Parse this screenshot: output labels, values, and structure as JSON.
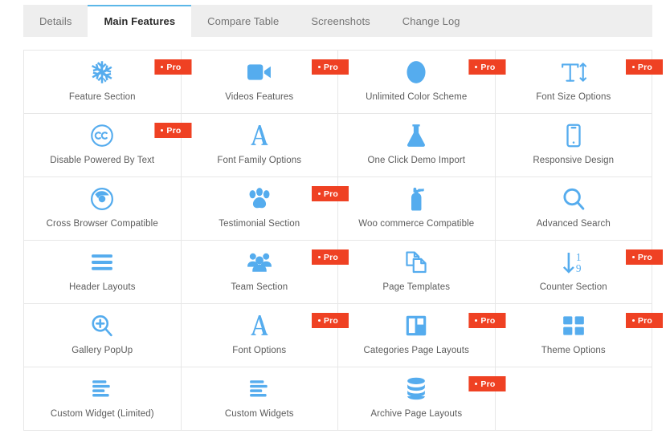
{
  "tabs": [
    {
      "label": "Details",
      "active": false
    },
    {
      "label": "Main Features",
      "active": true
    },
    {
      "label": "Compare Table",
      "active": false
    },
    {
      "label": "Screenshots",
      "active": false
    },
    {
      "label": "Change Log",
      "active": false
    }
  ],
  "colors": {
    "icon_blue": "#55acee",
    "pro_red": "#ef4123",
    "tab_active_underline": "#5bb7e8",
    "tabbar_background": "#eeeeee",
    "card_border": "#e7e7e7",
    "label_text": "#5b5b5b"
  },
  "pro_badge_label": "Pro",
  "features": [
    {
      "label": "Feature Section",
      "icon": "snowflake-icon",
      "pro": true
    },
    {
      "label": "Videos Features",
      "icon": "video-camera-icon",
      "pro": true
    },
    {
      "label": "Unlimited Color Scheme",
      "icon": "color-circle-icon",
      "pro": true
    },
    {
      "label": "Font Size Options",
      "icon": "font-size-icon",
      "pro": true
    },
    {
      "label": "Disable Powered By Text",
      "icon": "creative-commons-icon",
      "pro": true
    },
    {
      "label": "Font Family Options",
      "icon": "font-family-a-icon",
      "pro": false
    },
    {
      "label": "One Click Demo Import",
      "icon": "flask-icon",
      "pro": false
    },
    {
      "label": "Responsive Design",
      "icon": "mobile-phone-icon",
      "pro": false
    },
    {
      "label": "Cross Browser Compatible",
      "icon": "chrome-browser-icon",
      "pro": false
    },
    {
      "label": "Testimonial Section",
      "icon": "paw-print-icon",
      "pro": true
    },
    {
      "label": "Woo commerce Compatible",
      "icon": "fire-extinguisher-icon",
      "pro": false
    },
    {
      "label": "Advanced Search",
      "icon": "magnifier-icon",
      "pro": false
    },
    {
      "label": "Header Layouts",
      "icon": "hamburger-lines-icon",
      "pro": false
    },
    {
      "label": "Team Section",
      "icon": "users-group-icon",
      "pro": true
    },
    {
      "label": "Page Templates",
      "icon": "copy-pages-icon",
      "pro": false
    },
    {
      "label": "Counter Section",
      "icon": "sort-numeric-icon",
      "pro": true
    },
    {
      "label": "Gallery PopUp",
      "icon": "zoom-in-icon",
      "pro": false
    },
    {
      "label": "Font Options",
      "icon": "font-family-a-icon",
      "pro": true
    },
    {
      "label": "Categories Page Layouts",
      "icon": "columns-layout-icon",
      "pro": true
    },
    {
      "label": "Theme Options",
      "icon": "grid-squares-icon",
      "pro": true
    },
    {
      "label": "Custom Widget (Limited)",
      "icon": "align-left-bars-icon",
      "pro": false
    },
    {
      "label": "Custom Widgets",
      "icon": "align-left-bars-icon",
      "pro": false
    },
    {
      "label": "Archive Page Layouts",
      "icon": "database-icon",
      "pro": true
    },
    {
      "label": "",
      "icon": "",
      "pro": false,
      "empty": true
    }
  ]
}
